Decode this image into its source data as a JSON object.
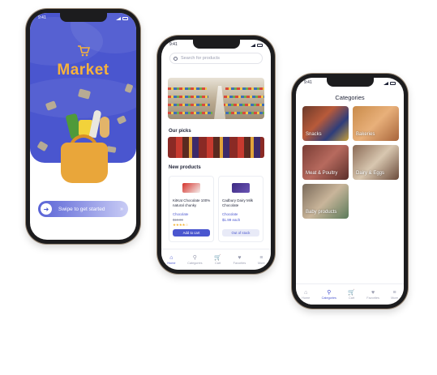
{
  "phone1": {
    "status_time": "9:41",
    "brand": "Market",
    "swipe_label": "Swipe to get started",
    "icons": [
      "cart-icon",
      "arrow-right-icon",
      "double-chevron-icon"
    ],
    "colors": {
      "primary": "#4a56cf",
      "accent": "#f6b23c"
    }
  },
  "phone2": {
    "status_time": "9:41",
    "search_placeholder": "Search for products",
    "our_picks_label": "Our picks",
    "new_products_label": "New products",
    "products": [
      {
        "name": "KitKat Chocolate 100% natural chunky",
        "category": "Chocolate",
        "old_price": "$10.00",
        "rating": "★★★★☆",
        "button": "Add to cart"
      },
      {
        "name": "Cadbury Dairy Milk Chocolate",
        "category": "Chocolate",
        "price": "$1.99 each",
        "button": "Out of stock"
      }
    ],
    "tabs": [
      {
        "label": "Home",
        "icon": "home-icon"
      },
      {
        "label": "Categories",
        "icon": "categories-icon"
      },
      {
        "label": "Cart",
        "icon": "cart-icon"
      },
      {
        "label": "Favorites",
        "icon": "heart-icon"
      },
      {
        "label": "More",
        "icon": "more-icon"
      }
    ]
  },
  "phone3": {
    "status_time": "9:41",
    "title": "Categories",
    "tiles": [
      {
        "label": "Snacks"
      },
      {
        "label": "Bakeries"
      },
      {
        "label": "Meat & Poultry"
      },
      {
        "label": "Dairy & Eggs"
      },
      {
        "label": "Baby products"
      }
    ],
    "tabs": [
      {
        "label": "Home",
        "icon": "home-icon"
      },
      {
        "label": "Categories",
        "icon": "categories-icon"
      },
      {
        "label": "Cart",
        "icon": "cart-icon"
      },
      {
        "label": "Favorites",
        "icon": "heart-icon"
      },
      {
        "label": "More",
        "icon": "more-icon"
      }
    ]
  }
}
